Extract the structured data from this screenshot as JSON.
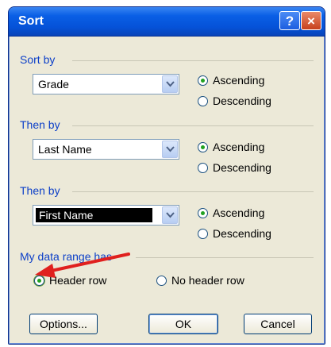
{
  "dialog": {
    "title": "Sort",
    "help_glyph": "?",
    "close_glyph": "×"
  },
  "groups": [
    {
      "label": "Sort by",
      "value": "Grade",
      "asc": "Ascending",
      "desc": "Descending",
      "selected": "asc"
    },
    {
      "label": "Then by",
      "value": "Last Name",
      "asc": "Ascending",
      "desc": "Descending",
      "selected": "asc"
    },
    {
      "label": "Then by",
      "value": "First Name",
      "asc": "Ascending",
      "desc": "Descending",
      "selected": "asc"
    }
  ],
  "header": {
    "label": "My data range has",
    "header_row": "Header row",
    "no_header_row": "No header row",
    "selected": "header_row"
  },
  "buttons": {
    "options": "Options...",
    "ok": "OK",
    "cancel": "Cancel"
  },
  "colors": {
    "titlebar": "#0552d8",
    "group_label": "#0c3fc8",
    "annotation_arrow": "#e0201e"
  }
}
